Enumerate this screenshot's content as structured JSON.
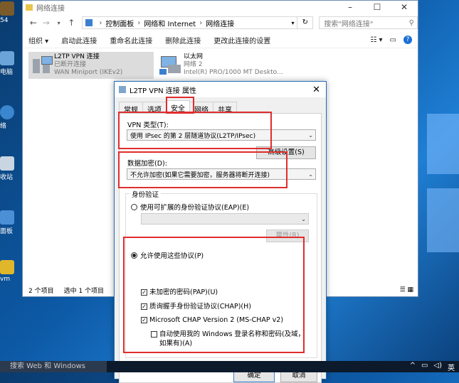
{
  "desktop": {
    "icons": [
      {
        "label": "54"
      },
      {
        "label": "电脑"
      },
      {
        "label": "络"
      },
      {
        "label": "收站"
      },
      {
        "label": "面板"
      },
      {
        "label": "vm"
      }
    ]
  },
  "explorer": {
    "title": "网络连接",
    "address": {
      "root_icon": "network-folder-icon",
      "crumbs": [
        "控制面板",
        "网络和 Internet",
        "网络连接"
      ]
    },
    "search_placeholder": "搜索\"网络连接\"",
    "commands": [
      "组织 ▾",
      "启动此连接",
      "重命名此连接",
      "删除此连接",
      "更改此连接的设置"
    ],
    "connections": [
      {
        "name": "L2TP VPN 连接",
        "status": "已断开连接",
        "device": "WAN Miniport (IKEv2)"
      },
      {
        "name": "以太网",
        "status": "网络 2",
        "device": "Intel(R) PRO/1000 MT Deskto..."
      }
    ],
    "status_left": "2 个项目",
    "status_selected": "选中 1 个项目"
  },
  "dialog": {
    "title": "L2TP VPN 连接 属性",
    "tabs": [
      "常规",
      "选项",
      "安全",
      "网络",
      "共享"
    ],
    "active_tab": "安全",
    "vpn_type_label": "VPN 类型(T):",
    "vpn_type_value": "使用 IPsec 的第 2 层隧道协议(L2TP/IPsec)",
    "advanced_button": "高级设置(S)",
    "encryption_label": "数据加密(D):",
    "encryption_value": "不允许加密(如果它需要加密，服务器将断开连接)",
    "auth_group_label": "身份验证",
    "eap_radio": "使用可扩展的身份验证协议(EAP)(E)",
    "eap_props_button": "属性(R)",
    "allow_radio": "允许使用这些协议(P)",
    "checks": [
      {
        "label": "未加密的密码(PAP)(U)",
        "checked": true
      },
      {
        "label": "质询握手身份验证协议(CHAP)(H)",
        "checked": true
      },
      {
        "label": "Microsoft CHAP Version 2 (MS-CHAP v2)",
        "checked": true
      }
    ],
    "auto_logon_check": "自动使用我的 Windows 登录名称和密码(及域，如果有)(A)",
    "ok_button": "确定",
    "cancel_button": "取消"
  },
  "taskbar": {
    "search": "搜索 Web 和 Windows",
    "tray": [
      "^",
      "▭",
      "◁)",
      "英"
    ]
  },
  "colors": {
    "highlight_red": "#e02d2d",
    "dialog_border": "#1f6fb8",
    "taskbar": "#0c1a2c"
  }
}
